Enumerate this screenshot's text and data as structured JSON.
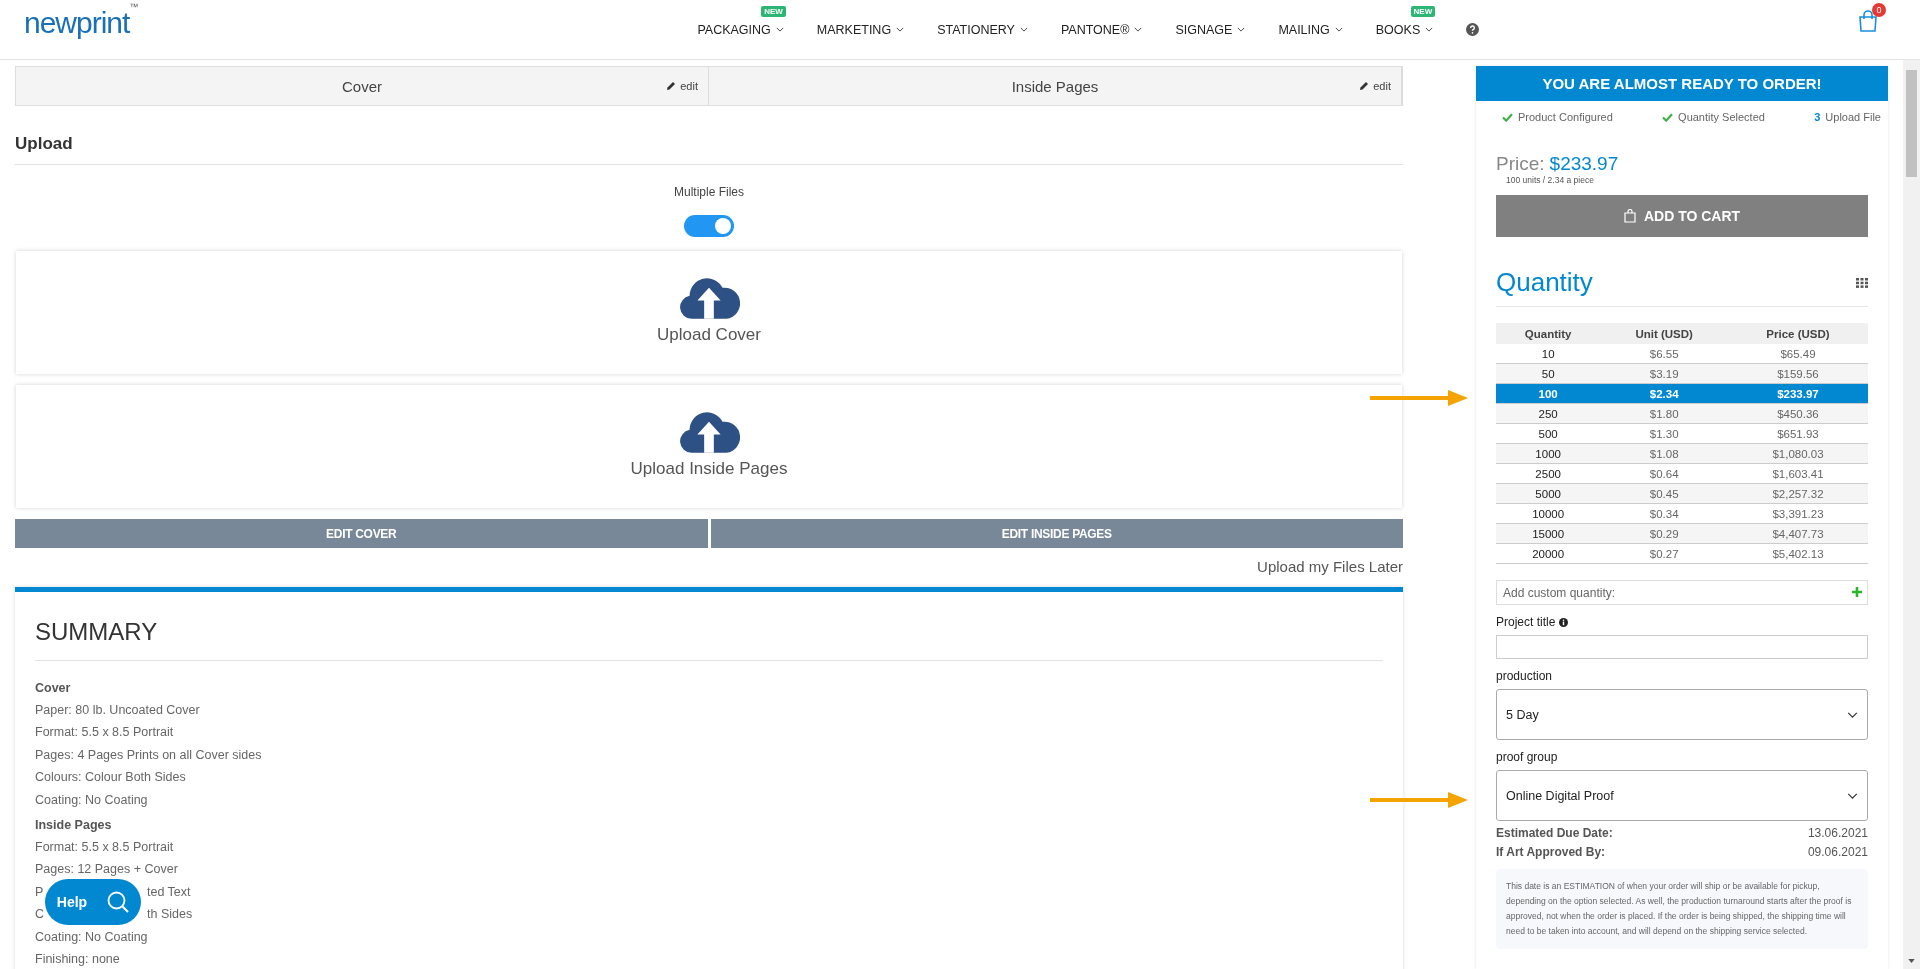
{
  "header": {
    "logo": {
      "text": "newprint",
      "mark": "™"
    },
    "nav": [
      {
        "label": "PACKAGING",
        "badge": "NEW"
      },
      {
        "label": "MARKETING"
      },
      {
        "label": "STATIONERY"
      },
      {
        "label": "PANTONE®"
      },
      {
        "label": "SIGNAGE"
      },
      {
        "label": "MAILING"
      },
      {
        "label": "BOOKS",
        "badge": "NEW"
      }
    ],
    "cart_count": "0"
  },
  "parts_tabs": [
    {
      "label": "Cover",
      "edit": "edit"
    },
    {
      "label": "Inside Pages",
      "edit": "edit"
    }
  ],
  "upload": {
    "title": "Upload",
    "toggle_label": "Multiple Files",
    "multiple_files": true,
    "dropzones": [
      "Upload Cover",
      "Upload Inside Pages"
    ],
    "edit_buttons": [
      "EDIT COVER",
      "EDIT INSIDE PAGES"
    ],
    "later_link": "Upload my Files Later"
  },
  "summary": {
    "title": "SUMMARY",
    "sections": [
      {
        "heading": "Cover",
        "lines": [
          {
            "kind": "text",
            "text": "Paper: 80 lb. Uncoated Cover"
          },
          {
            "kind": "text",
            "text": "Format: 5.5 x 8.5 Portrait"
          },
          {
            "kind": "text",
            "text": "Pages: 4 Pages Prints on all Cover sides"
          },
          {
            "kind": "text",
            "text": "Colours: Colour Both Sides"
          },
          {
            "kind": "text",
            "text": "Coating: No Coating"
          }
        ]
      },
      {
        "heading": "Inside Pages",
        "lines": [
          {
            "kind": "text",
            "text": "Format: 5.5 x 8.5 Portrait"
          },
          {
            "kind": "text",
            "text": "Pages: 12 Pages + Cover"
          },
          {
            "kind": "covered",
            "start": "P",
            "end": "ted Text"
          },
          {
            "kind": "covered",
            "start": "C",
            "end": "th Sides"
          },
          {
            "kind": "text",
            "text": "Coating: No Coating"
          },
          {
            "kind": "text",
            "text": "Finishing: none"
          }
        ]
      }
    ]
  },
  "help_button": "Help",
  "order_panel": {
    "banner": "YOU ARE ALMOST READY TO ORDER!",
    "steps": [
      {
        "kind": "done",
        "label": "Product Configured"
      },
      {
        "kind": "done",
        "label": "Quantity Selected"
      },
      {
        "kind": "number",
        "number": "3",
        "label": "Upload File"
      }
    ],
    "price_label": "Price:",
    "price": "$233.97",
    "price_note": "100 units / 2.34 a piece",
    "add_to_cart": "ADD TO CART",
    "quantity_title": "Quantity",
    "table": {
      "columns": [
        "Quantity",
        "Unit (USD)",
        "Price (USD)"
      ],
      "rows": [
        {
          "cells": [
            "10",
            "$6.55",
            "$65.49"
          ],
          "selected": false
        },
        {
          "cells": [
            "50",
            "$3.19",
            "$159.56"
          ],
          "selected": false
        },
        {
          "cells": [
            "100",
            "$2.34",
            "$233.97"
          ],
          "selected": true
        },
        {
          "cells": [
            "250",
            "$1.80",
            "$450.36"
          ],
          "selected": false
        },
        {
          "cells": [
            "500",
            "$1.30",
            "$651.93"
          ],
          "selected": false
        },
        {
          "cells": [
            "1000",
            "$1.08",
            "$1,080.03"
          ],
          "selected": false
        },
        {
          "cells": [
            "2500",
            "$0.64",
            "$1,603.41"
          ],
          "selected": false
        },
        {
          "cells": [
            "5000",
            "$0.45",
            "$2,257.32"
          ],
          "selected": false
        },
        {
          "cells": [
            "10000",
            "$0.34",
            "$3,391.23"
          ],
          "selected": false
        },
        {
          "cells": [
            "15000",
            "$0.29",
            "$4,407.73"
          ],
          "selected": false
        },
        {
          "cells": [
            "20000",
            "$0.27",
            "$5,402.13"
          ],
          "selected": false
        }
      ]
    },
    "custom_quantity": {
      "placeholder": "Add custom quantity:"
    },
    "project_title": {
      "label": "Project title"
    },
    "selects": [
      {
        "label": "production",
        "value": "5 Day"
      },
      {
        "label": "proof group",
        "value": "Online Digital Proof"
      }
    ],
    "dates": [
      {
        "label": "Estimated Due Date:",
        "value": "13.06.2021"
      },
      {
        "label": "If Art Approved By:",
        "value": "09.06.2021"
      }
    ],
    "note": "This date is an ESTIMATION of when your order will ship or be available for pickup, depending on the option selected. As well, the production turnaround starts after the proof is approved, not when the order is placed. If the order is being shipped, the shipping time will need to be taken into account, and will depend on the shipping service selected."
  }
}
